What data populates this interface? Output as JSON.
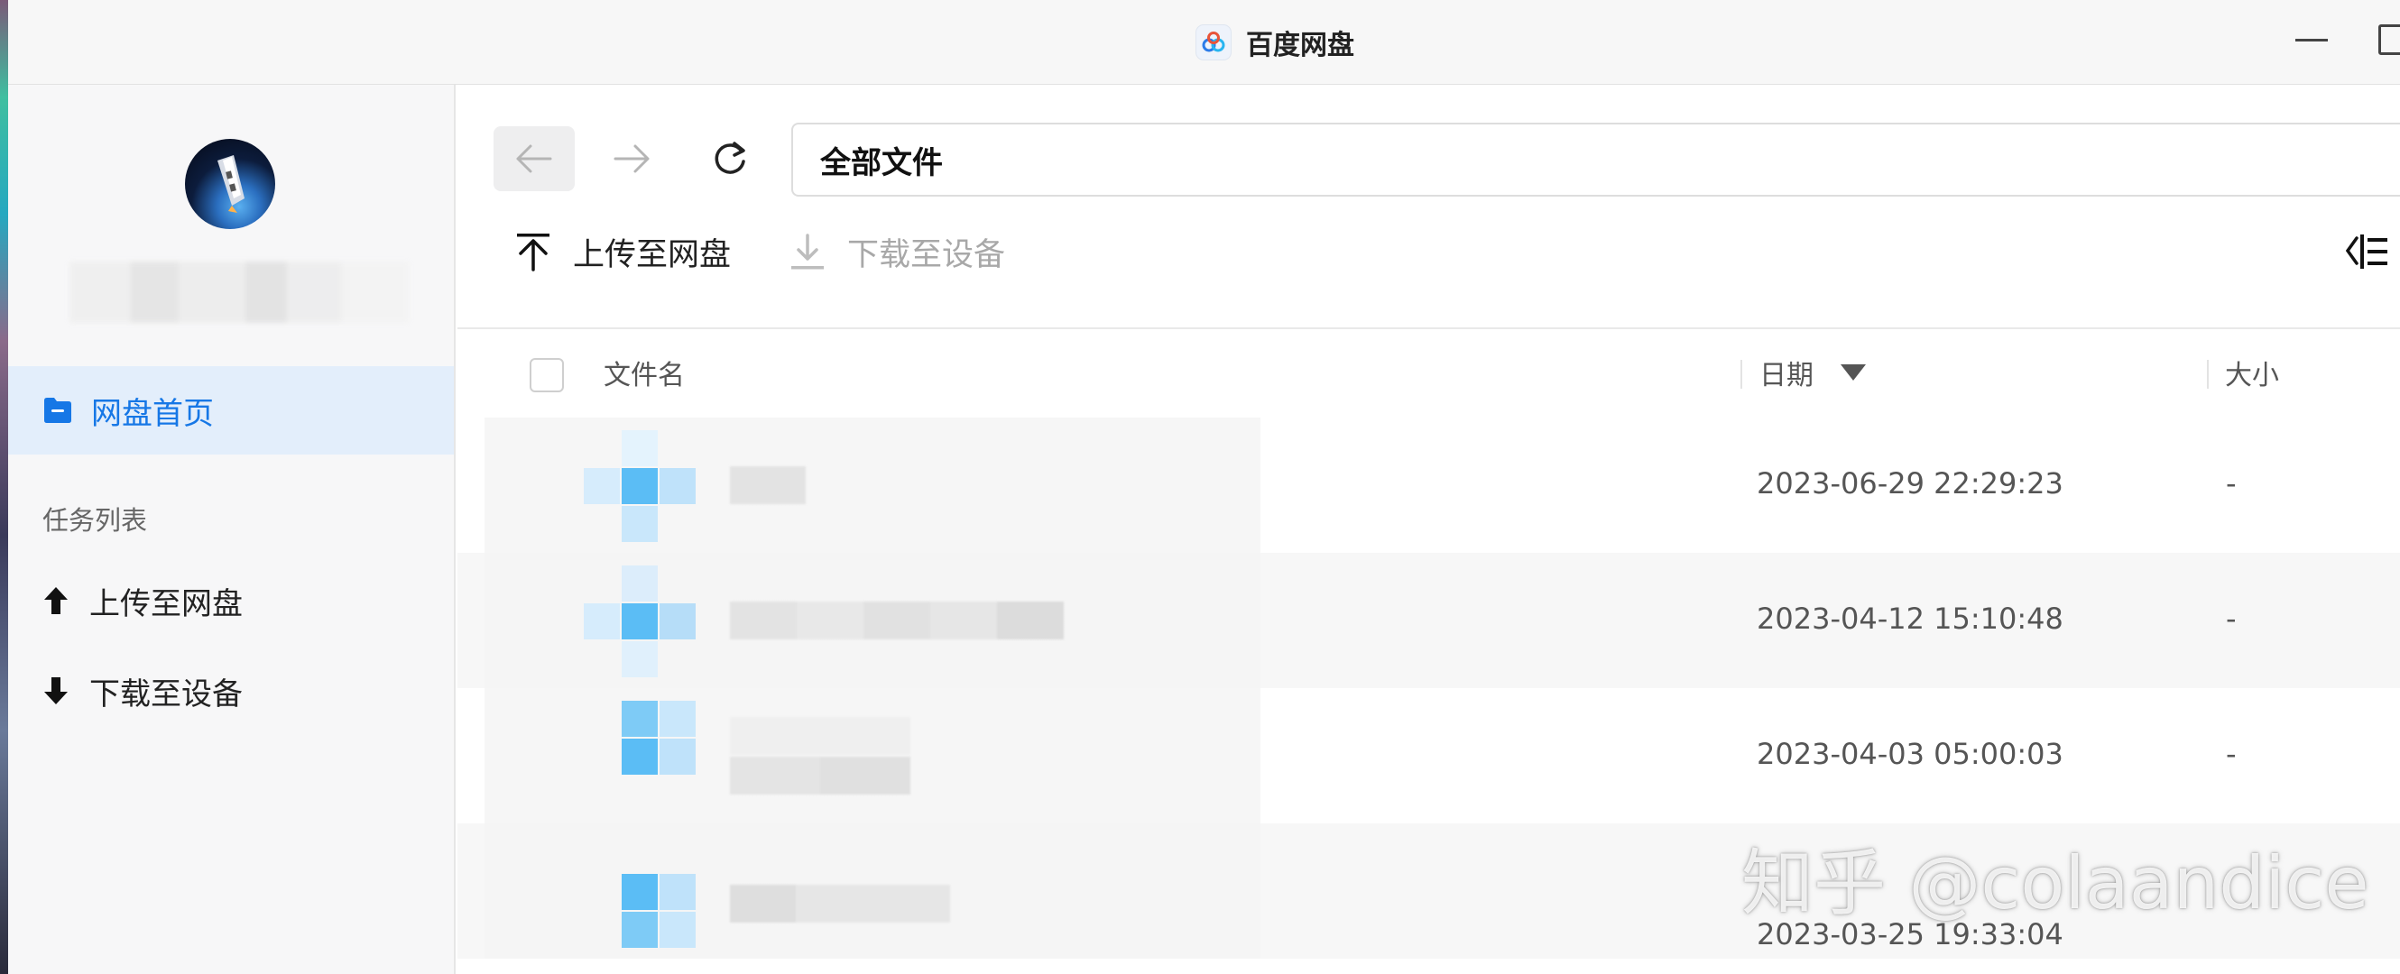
{
  "window": {
    "title": "百度网盘"
  },
  "sidebar": {
    "nav_home": {
      "label": "网盘首页",
      "icon": "folder-icon"
    },
    "section_title": "任务列表",
    "items": [
      {
        "label": "上传至网盘",
        "icon": "arrow-up-icon"
      },
      {
        "label": "下载至设备",
        "icon": "arrow-down-icon"
      }
    ]
  },
  "main": {
    "path": "全部文件",
    "toolbar": {
      "upload_label": "上传至网盘",
      "download_label": "下载至设备"
    },
    "table": {
      "headers": {
        "name": "文件名",
        "date": "日期",
        "size": "大小"
      },
      "rows": [
        {
          "date": "2023-06-29 22:29:23",
          "size": "-"
        },
        {
          "date": "2023-04-12 15:10:48",
          "size": "-"
        },
        {
          "date": "2023-04-03 05:00:03",
          "size": "-"
        },
        {
          "date": "2023-03-25 19:33:04",
          "size": ""
        }
      ]
    }
  },
  "watermark": "知乎 @colaandice",
  "colors": {
    "accent": "#1677e6",
    "nav_active_bg": "#e3eefb",
    "disabled_text": "#a8a8a8"
  }
}
